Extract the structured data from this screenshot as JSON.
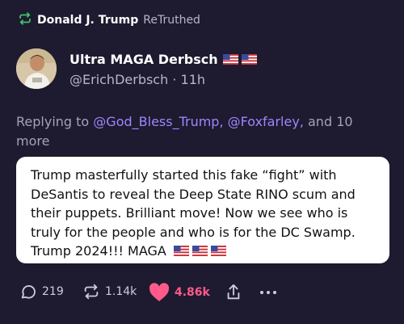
{
  "retruth": {
    "icon": "retruth-icon",
    "name": "Donald J. Trump",
    "verb": "ReTruthed"
  },
  "author": {
    "display_name": "Ultra MAGA Derbsch",
    "handle": "@ErichDerbsch",
    "separator": "·",
    "time": "11h",
    "badges": [
      "us-flag-icon",
      "us-flag-icon"
    ]
  },
  "reply": {
    "prefix": "Replying to",
    "mention_1": "@God_Bless_Trump,",
    "mention_2": "@Foxfarley,",
    "suffix": "and 10 more"
  },
  "post": {
    "text": "Trump masterfully started this fake “fight” with DeSantis to reveal the Deep State RINO scum and their puppets. Brilliant move! Now we see who is truly for the people and who is for the DC Swamp. Trump 2024!!! MAGA",
    "emoji": [
      "us-flag-icon",
      "us-flag-icon",
      "us-flag-icon"
    ]
  },
  "actions": {
    "replies": "219",
    "retruths": "1.14k",
    "likes": "4.86k",
    "share_icon": "share-icon",
    "more_icon": "more-icon"
  },
  "colors": {
    "background": "#1e1a2f",
    "accent_green": "#3fc36b",
    "mention": "#9f86ff",
    "like": "#ff5a8a"
  }
}
